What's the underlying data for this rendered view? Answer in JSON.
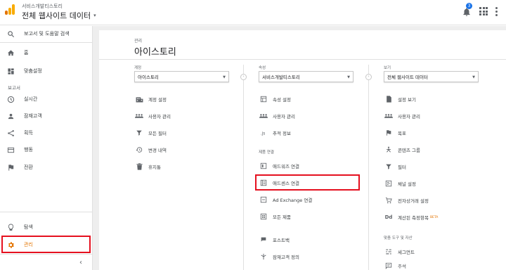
{
  "header": {
    "account_small": "서비스개발티스토리",
    "account_big": "전체 웹사이트 데이터",
    "caret": "▾",
    "notification_count": "3"
  },
  "sidebar": {
    "search": "보고서 및 도움말 검색",
    "home": "홈",
    "custom": "맞춤설정",
    "section": "보고서",
    "realtime": "실시간",
    "audience": "잠재고객",
    "acquisition": "획득",
    "behavior": "행동",
    "conversion": "전환",
    "discover": "탐색",
    "admin": "관리",
    "collapse": "‹"
  },
  "main": {
    "breadcrumb": "관리",
    "title": "아이스토리"
  },
  "columns": {
    "account": {
      "label": "계정",
      "selected": "아이스토리",
      "items": [
        "계정 설정",
        "사용자 관리",
        "모든 필터",
        "변경 내역",
        "휴지통"
      ]
    },
    "property": {
      "label": "속성",
      "selected": "서비스개발티스토리",
      "items": [
        "속성 설정",
        "사용자 관리",
        "추적 정보"
      ],
      "product_section": "제품 연결",
      "product_items": [
        "애드워즈 연결",
        "애드센스 연결",
        "Ad Exchange 연결",
        "모든 제품"
      ],
      "more_items": [
        "포스트백",
        "잠재고객 정의"
      ]
    },
    "view": {
      "label": "보기",
      "selected": "전체 웹사이트 데이터",
      "items": [
        "설정 보기",
        "사용자 관리",
        "목표",
        "콘텐츠 그룹",
        "필터",
        "채널 설정",
        "전자상거래 설정",
        "계산된 측정항목"
      ],
      "beta": "BETA",
      "tools_section": "맞춤 도구 및 자산",
      "tools_items": [
        "세그먼트",
        "주석"
      ]
    }
  },
  "colors": {
    "highlight": "#e5101f",
    "accent": "#e37400",
    "badge": "#1a73e8"
  }
}
